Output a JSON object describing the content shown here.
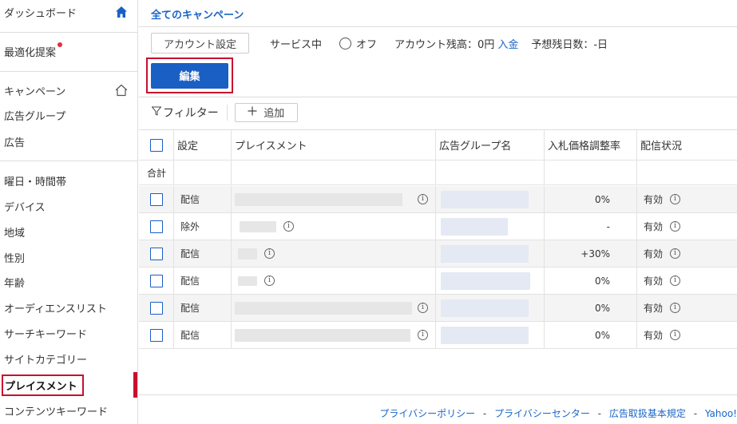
{
  "sidebar": {
    "items": [
      {
        "label": "ダッシュボード"
      },
      {
        "label": "最適化提案"
      },
      {
        "label": "キャンペーン"
      },
      {
        "label": "広告グループ"
      },
      {
        "label": "広告"
      },
      {
        "label": "曜日・時間帯"
      },
      {
        "label": "デバイス"
      },
      {
        "label": "地域"
      },
      {
        "label": "性別"
      },
      {
        "label": "年齢"
      },
      {
        "label": "オーディエンスリスト"
      },
      {
        "label": "サーチキーワード"
      },
      {
        "label": "サイトカテゴリー"
      },
      {
        "label": "プレイスメント"
      },
      {
        "label": "コンテンツキーワード"
      }
    ],
    "active": "プレイスメント",
    "accent_color": "#c8102e"
  },
  "header": {
    "title": "全てのキャンペーン"
  },
  "account": {
    "settings_button": "アカウント設定",
    "service_status": "サービス中",
    "off_label": "オフ",
    "balance_label": "アカウント残高：0円",
    "deposit_link": "入金",
    "days_label": "予想残日数：-日"
  },
  "toolbar": {
    "edit_label": "編集",
    "filter_label": "フィルター",
    "add_label": "追加"
  },
  "table": {
    "columns": [
      "設定",
      "プレイスメント",
      "広告グループ名",
      "入札価格調整率",
      "配信状況"
    ],
    "total_label": "合計",
    "rows": [
      {
        "setting": "配信",
        "bid": "0%",
        "status": "有効"
      },
      {
        "setting": "除外",
        "bid": "-",
        "status": "有効"
      },
      {
        "setting": "配信",
        "bid": "+30%",
        "status": "有効"
      },
      {
        "setting": "配信",
        "bid": "0%",
        "status": "有効"
      },
      {
        "setting": "配信",
        "bid": "0%",
        "status": "有効"
      },
      {
        "setting": "配信",
        "bid": "0%",
        "status": "有効"
      }
    ]
  },
  "footer": {
    "privacy_policy": "プライバシーポリシー",
    "privacy_center": "プライバシーセンター",
    "terms": "広告取扱基本規定",
    "yahoo": "Yahoo!",
    "separator": "-"
  },
  "colors": {
    "primary": "#1a5fc4",
    "link": "#1a66c8",
    "highlight": "#c8102e"
  }
}
